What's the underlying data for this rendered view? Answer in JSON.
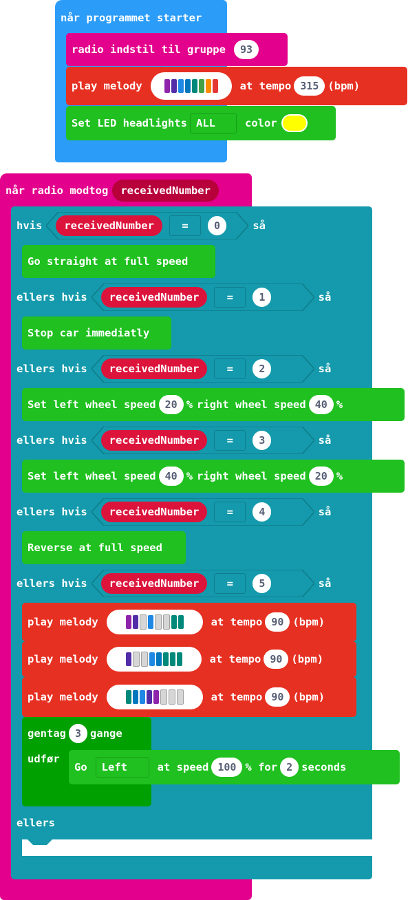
{
  "colors": {
    "events_blue": "#2c9cf9",
    "radio_magenta": "#e3008c",
    "music_red": "#e63022",
    "car_green": "#1fc01f",
    "repeat_green": "#00a000",
    "logic_teal": "#149aac",
    "var_red": "#dc143c",
    "led_yellow": "#ffff00",
    "field_text": "#575e75"
  },
  "on_start": {
    "label": "når programmet starter",
    "radio_group": {
      "label": "radio indstil til gruppe",
      "value": "93"
    },
    "play_melody": {
      "label": "play melody",
      "tempo_label": "at tempo",
      "tempo": "315",
      "unit": "(bpm)",
      "notes": [
        "#8e24aa",
        "#512da8",
        "#1e88e5",
        "#0277bd",
        "#00897b",
        "#43a047",
        "#fb8c00",
        "#e53935"
      ]
    },
    "led": {
      "label": "Set LED headlights",
      "dropdown": "ALL",
      "color_label": "color",
      "color": "#ffff00"
    }
  },
  "on_radio": {
    "label": "når radio modtog",
    "param": "receivedNumber",
    "if_label": "hvis",
    "then_label": "så",
    "elseif_label": "ellers hvis",
    "else_label": "ellers",
    "eq": "=",
    "var": "receivedNumber",
    "branches": [
      {
        "value": "0",
        "action": "Go straight at full speed"
      },
      {
        "value": "1",
        "action": "Stop car immediatly"
      },
      {
        "value": "2",
        "left_label": "Set left wheel speed",
        "left": "20",
        "pct": "%",
        "right_label": "right wheel speed",
        "right": "40"
      },
      {
        "value": "3",
        "left_label": "Set left wheel speed",
        "left": "40",
        "pct": "%",
        "right_label": "right wheel speed",
        "right": "20"
      },
      {
        "value": "4",
        "action": "Reverse at full speed"
      },
      {
        "value": "5"
      }
    ],
    "melodies": [
      {
        "label": "play melody",
        "tempo_label": "at tempo",
        "tempo": "90",
        "unit": "(bpm)",
        "notes": [
          "#8e24aa",
          "#512da8",
          "#d6d6d6",
          "#1e88e5",
          "#d6d6d6",
          "#d6d6d6",
          "#00897b",
          "#00897b"
        ]
      },
      {
        "label": "play melody",
        "tempo_label": "at tempo",
        "tempo": "90",
        "unit": "(bpm)",
        "notes": [
          "#512da8",
          "#d6d6d6",
          "#d6d6d6",
          "#1e88e5",
          "#0277bd",
          "#00897b",
          "#00897b",
          "#00897b"
        ]
      },
      {
        "label": "play melody",
        "tempo_label": "at tempo",
        "tempo": "90",
        "unit": "(bpm)",
        "notes": [
          "#00897b",
          "#0277bd",
          "#1e88e5",
          "#512da8",
          "#8e24aa",
          "#d6d6d6",
          "#d6d6d6",
          "#d6d6d6"
        ]
      }
    ],
    "repeat": {
      "label": "gentag",
      "times": "3",
      "times_label": "gange",
      "do_label": "udfør"
    },
    "go": {
      "label": "Go",
      "direction": "Left",
      "speed_label": "at speed",
      "speed": "100",
      "pct_for": "% for",
      "seconds": "2",
      "seconds_label": "seconds"
    }
  }
}
